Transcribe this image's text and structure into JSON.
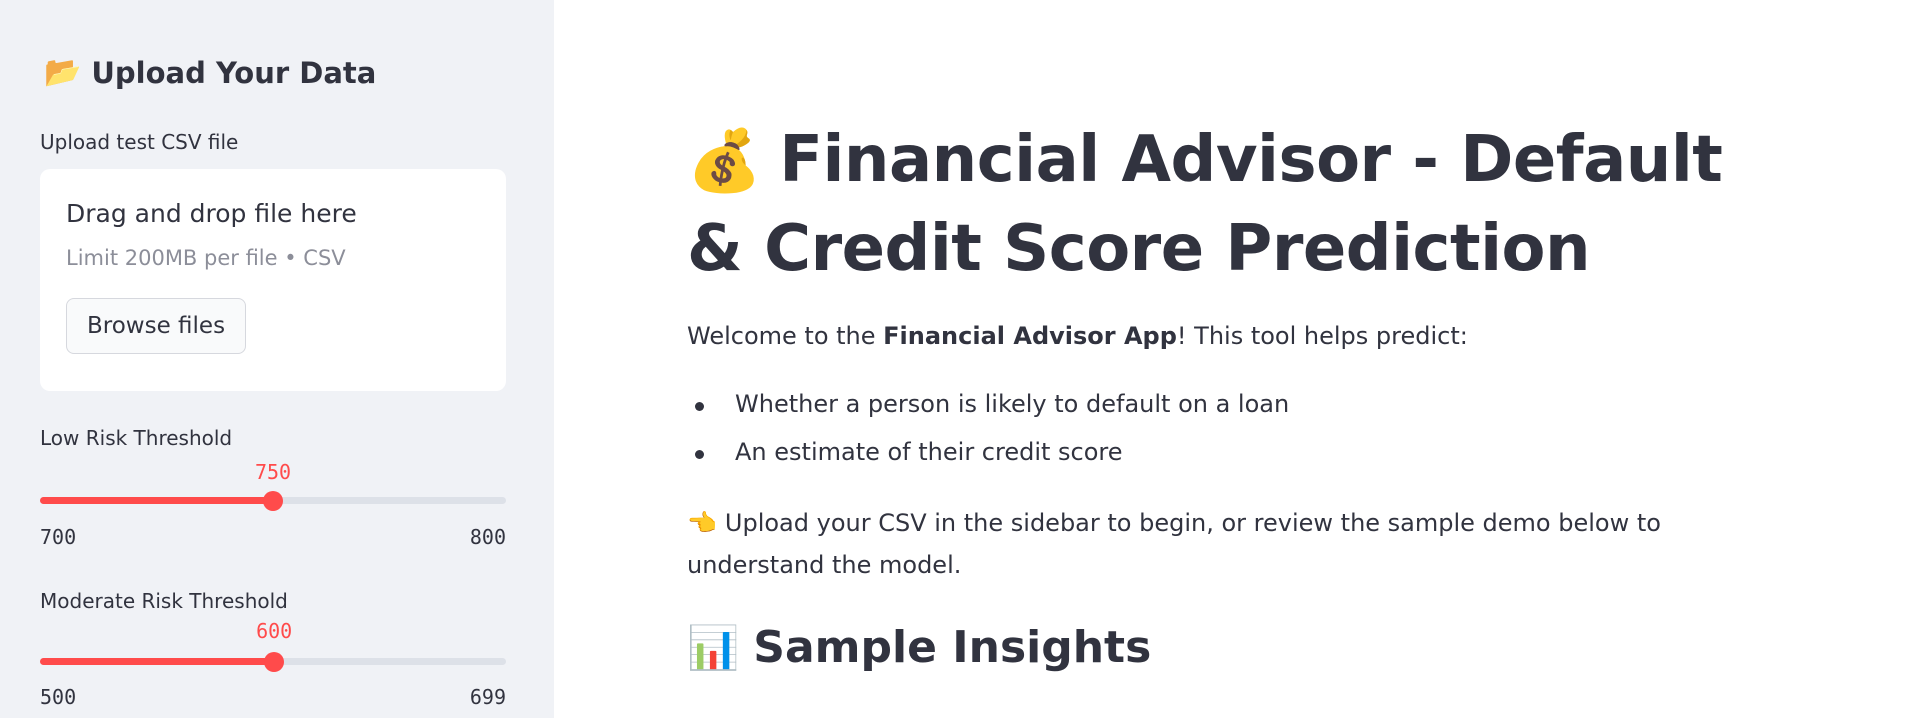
{
  "sidebar": {
    "header": {
      "icon": "folder-icon",
      "glyph": "📂",
      "title": "Upload Your Data"
    },
    "upload": {
      "label": "Upload test CSV file",
      "dropzone_title": "Drag and drop file here",
      "dropzone_sub": "Limit 200MB per file • CSV",
      "browse_label": "Browse files"
    },
    "sliders": [
      {
        "label": "Low Risk Threshold",
        "value": "750",
        "min": "700",
        "max": "800",
        "fraction": 0.5
      },
      {
        "label": "Moderate Risk Threshold",
        "value": "600",
        "min": "500",
        "max": "699",
        "fraction": 0.5025
      }
    ]
  },
  "main": {
    "title_icon": "money-bag-icon",
    "title_glyph": "💰",
    "title": "Financial Advisor - Default & Credit Score Prediction",
    "welcome_prefix": "Welcome to the ",
    "welcome_bold": "Financial Advisor App",
    "welcome_suffix": "! This tool helps predict:",
    "bullets": [
      "Whether a person is likely to default on a loan",
      "An estimate of their credit score"
    ],
    "instruction_icon": "pointing-hand-icon",
    "instruction_glyph": "👈",
    "instruction": "Upload your CSV in the sidebar to begin, or review the sample demo below to understand the model.",
    "section_icon": "bar-chart-icon",
    "section_glyph": "📊",
    "section_title": "Sample Insights"
  },
  "colors": {
    "accent": "#ff4b4b",
    "sidebar_bg": "#f0f2f6",
    "text": "#31333f"
  }
}
